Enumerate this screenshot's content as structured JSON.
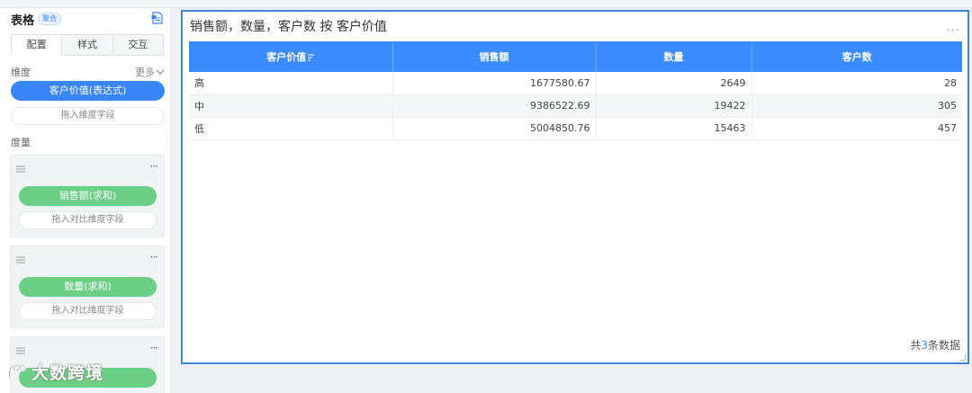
{
  "panel": {
    "title": "表格",
    "badge": "聚合",
    "tabs": [
      {
        "label": "配置",
        "active": true
      },
      {
        "label": "样式",
        "active": false
      },
      {
        "label": "交互",
        "active": false
      }
    ],
    "dimension_label": "维度",
    "more_label": "更多",
    "dimension_field": "客户价值(表达式)",
    "dimension_drop": "拖入维度字段",
    "measure_label": "度量",
    "measures": [
      {
        "field": "销售额(求和)",
        "drop": "拖入对比维度字段"
      },
      {
        "field": "数量(求和)",
        "drop": "拖入对比维度字段"
      }
    ],
    "watermark": "大数跨境"
  },
  "colors": {
    "accent": "#3a8bfd",
    "dimension_pill": "#3a86f8",
    "measure_pill": "#6ccf86",
    "frame_border": "#3f86d6"
  },
  "chart": {
    "title": "销售额，数量，客户数 按 客户价值",
    "more": "...",
    "columns": [
      "客户价值",
      "销售额",
      "数量",
      "客户数"
    ],
    "rows": [
      [
        "高",
        "1677580.67",
        "2649",
        "28"
      ],
      [
        "中",
        "9386522.69",
        "19422",
        "305"
      ],
      [
        "低",
        "5004850.76",
        "15463",
        "457"
      ]
    ],
    "footer_prefix": "共",
    "footer_count": "3",
    "footer_suffix": "条数据"
  }
}
